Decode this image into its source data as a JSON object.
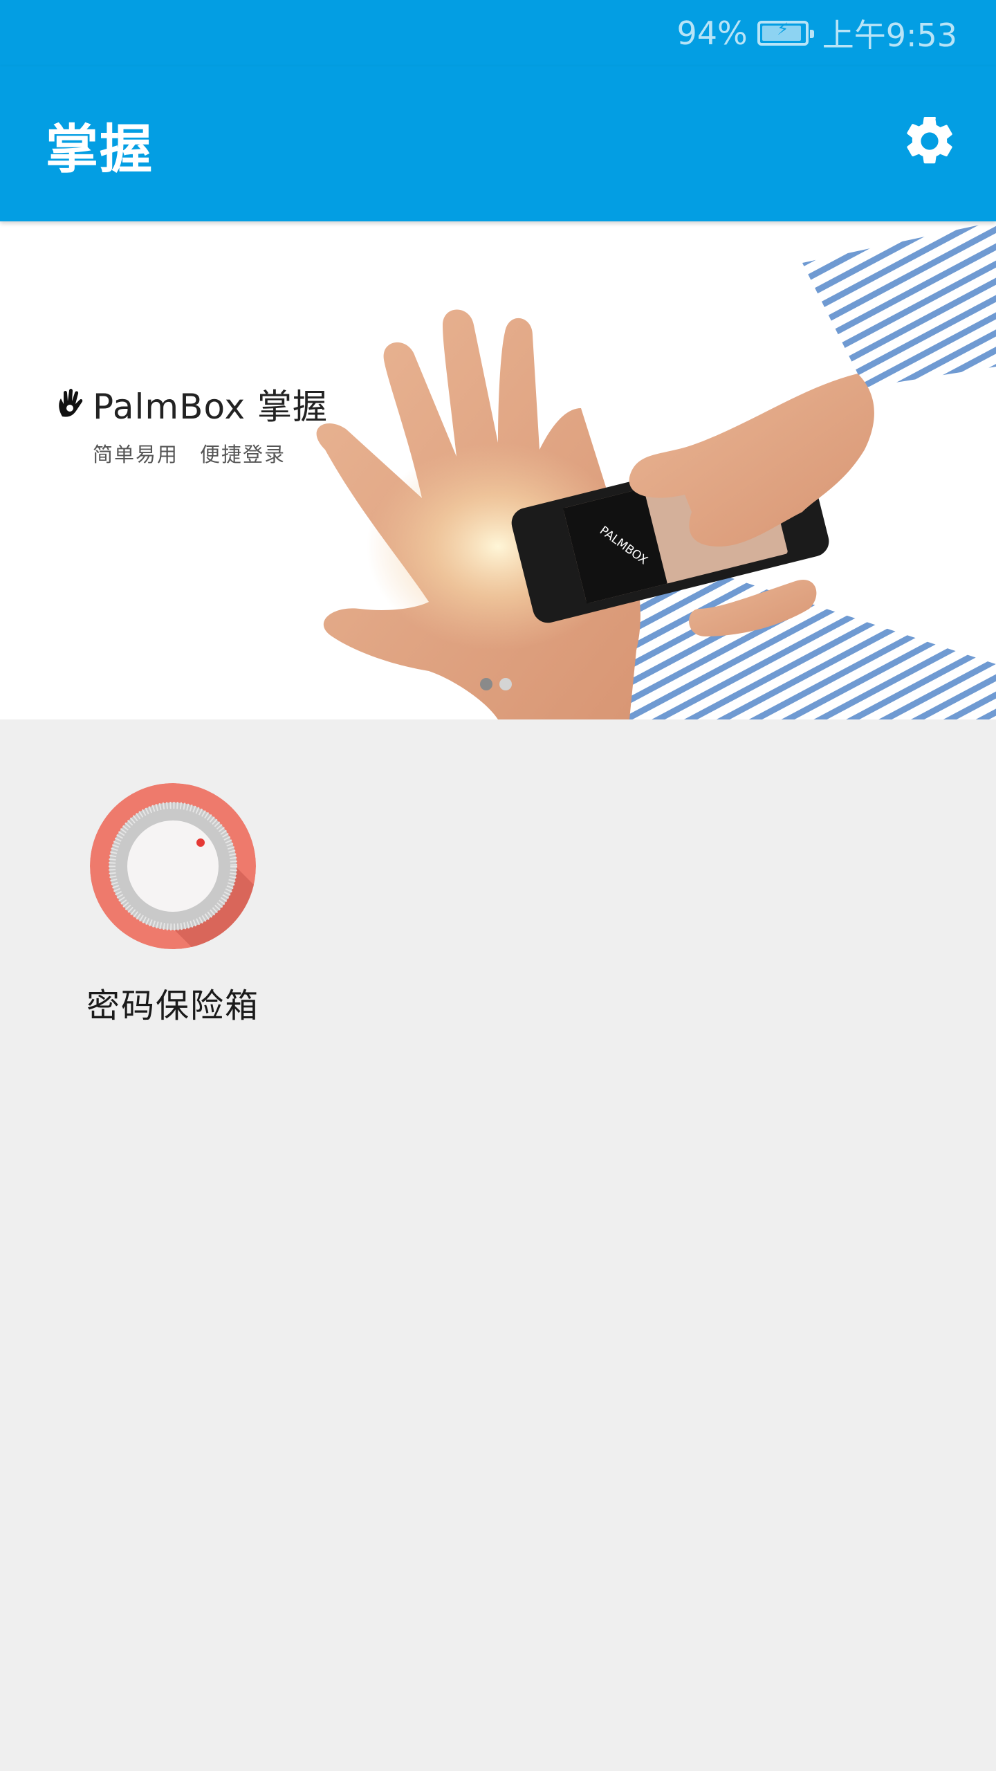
{
  "status_bar": {
    "battery_percent_text": "94%",
    "battery_level": 0.94,
    "time": "上午9:53"
  },
  "app_bar": {
    "title": "掌握",
    "settings_icon": "gear-icon"
  },
  "banner": {
    "brand_title": "PalmBox 掌握",
    "brand_subtitle": "简单易用　便捷登录",
    "phone_screen_text": "PALMBOX",
    "pager": {
      "count": 2,
      "active_index": 0
    }
  },
  "tiles": [
    {
      "label": "密码保险箱",
      "icon": "safe-dial-icon"
    }
  ],
  "colors": {
    "primary": "#039ee3",
    "background": "#efefef",
    "vault_red": "#ee7a6c",
    "dial_dot": "#e53935"
  }
}
